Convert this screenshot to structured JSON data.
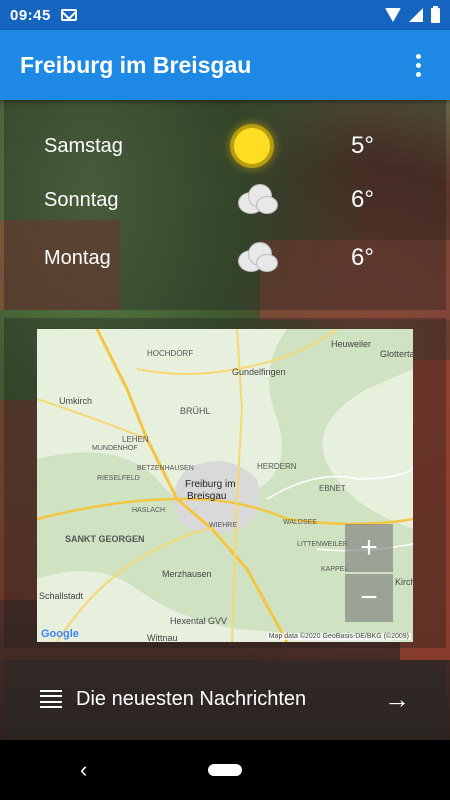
{
  "status": {
    "time": "09:45"
  },
  "appbar": {
    "title": "Freiburg im Breisgau"
  },
  "forecast": [
    {
      "day": "Samstag",
      "temp": "5°",
      "icon": "sun-icon"
    },
    {
      "day": "Sonntag",
      "temp": "6°",
      "icon": "cloud-icon"
    },
    {
      "day": "Montag",
      "temp": "6°",
      "icon": "cloud-icon"
    }
  ],
  "map": {
    "labels": {
      "hochdorf": "HOCHDORF",
      "gundelfingen": "Gundelfingen",
      "heuweiler": "Heuweiler",
      "glottertal": "Glotterta",
      "umkirch": "Umkirch",
      "bruhl": "BRÜHL",
      "lehen": "LEHEN",
      "mundenhof": "MUNDENHOF",
      "herdern": "HERDERN",
      "betzenhausen": "BETZENHAUSEN",
      "rieselfeld": "RIESELFELD",
      "freiburg": "Freiburg im",
      "breisgau": "Breisgau",
      "ebnet": "EBNET",
      "haslach": "HASLACH",
      "wiehre": "WIEHRE",
      "waldsee": "WALDSEE",
      "sanktgeorgen": "SANKT GEORGEN",
      "littenweiler": "LITTENWEILER",
      "merzhausen": "Merzhausen",
      "kappel": "KAPPEL",
      "schallstadt": "Schallstadt",
      "kirch": "Kirch",
      "hexental": "Hexental GVV",
      "wittnau": "Wittnau"
    },
    "google": "Google",
    "credit": "Map data ©2020 GeoBasis-DE/BKG (©2009)",
    "zoom_in": "+",
    "zoom_out": "−"
  },
  "news": {
    "label": "Die neuesten Nachrichten",
    "arrow": "→"
  },
  "nav": {
    "back": "‹"
  }
}
